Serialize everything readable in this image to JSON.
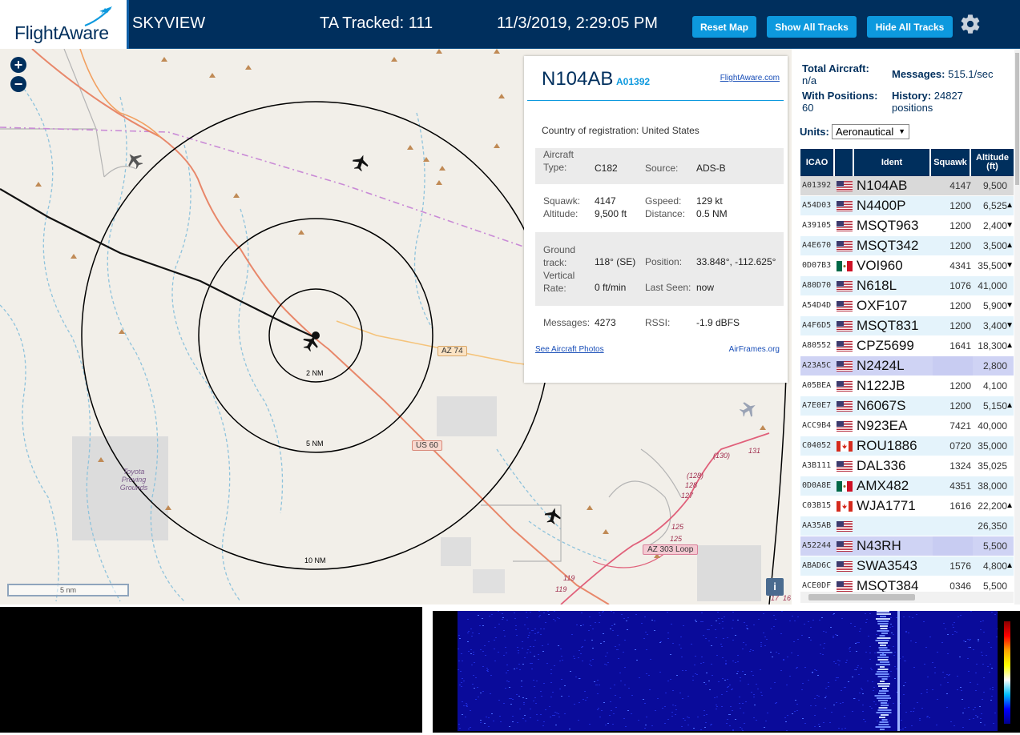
{
  "header": {
    "logo": "FlightAware",
    "site_name": "SKYVIEW",
    "ta_tracked": "TA Tracked: 111",
    "datetime": "11/3/2019, 2:29:05 PM",
    "buttons": {
      "reset": "Reset Map",
      "show": "Show All Tracks",
      "hide": "Hide All Tracks"
    },
    "colors": {
      "bar": "#002f5d",
      "button": "#0d99de"
    }
  },
  "map": {
    "zoom_in": "+",
    "zoom_out": "−",
    "range_labels": [
      "2 NM",
      "5 NM",
      "10 NM"
    ],
    "road_labels": [
      "AZ 74",
      "US 60",
      "AZ 303 Loop"
    ],
    "route_numbers": [
      "(130)",
      "131",
      "(128)",
      "128",
      "127",
      "125",
      "125",
      "119",
      "119",
      "17",
      "16"
    ],
    "place_label": "Toyota Proving Grounds",
    "scale": "5 nm",
    "info": "i"
  },
  "popup": {
    "ident": "N104AB",
    "icao": "A01392",
    "flightaware_link": "FlightAware.com",
    "country_label": "Country of registration:",
    "country": "United States",
    "aircraft_type_label": "Aircraft Type:",
    "aircraft_type": "C182",
    "source_label": "Source:",
    "source": "ADS-B",
    "squawk_label": "Squawk:",
    "squawk": "4147",
    "gspeed_label": "Gspeed:",
    "gspeed": "129 kt",
    "altitude_label": "Altitude:",
    "altitude": "9,500 ft",
    "distance_label": "Distance:",
    "distance": "0.5 NM",
    "ground_track_label": "Ground track:",
    "ground_track": "118° (SE)",
    "position_label": "Position:",
    "position": "33.848°, -112.625°",
    "vrate_label": "Vertical Rate:",
    "vrate": "0 ft/min",
    "last_seen_label": "Last Seen:",
    "last_seen": "now",
    "messages_label": "Messages:",
    "messages": "4273",
    "rssi_label": "RSSI:",
    "rssi": "-1.9 dBFS",
    "photos_link": "See Aircraft Photos",
    "airframes_link": "AirFrames.org"
  },
  "panel": {
    "total_aircraft_label": "Total Aircraft:",
    "total_aircraft": "n/a",
    "messages_label": "Messages:",
    "messages": "515.1/sec",
    "with_positions_label": "With Positions:",
    "with_positions": "60",
    "history_label": "History:",
    "history": "24827 positions",
    "units_label": "Units:",
    "units_value": "Aeronautical",
    "columns": [
      "ICAO",
      "",
      "Ident",
      "Squawk",
      "Altitude (ft)"
    ],
    "rows": [
      {
        "icao": "A01392",
        "flag": "us",
        "ident": "N104AB",
        "squawk": "4147",
        "alt": "9,500",
        "trend": "",
        "state": "sel"
      },
      {
        "icao": "A54D03",
        "flag": "us",
        "ident": "N4400P",
        "squawk": "1200",
        "alt": "6,525",
        "trend": "▲",
        "state": "odd"
      },
      {
        "icao": "A39105",
        "flag": "us",
        "ident": "MSQT963",
        "squawk": "1200",
        "alt": "2,400",
        "trend": "▼",
        "state": "even"
      },
      {
        "icao": "A4E670",
        "flag": "us",
        "ident": "MSQT342",
        "squawk": "1200",
        "alt": "3,500",
        "trend": "▲",
        "state": "odd"
      },
      {
        "icao": "0D07B3",
        "flag": "mx",
        "ident": "VOI960",
        "squawk": "4341",
        "alt": "35,500",
        "trend": "▼",
        "state": "even"
      },
      {
        "icao": "A80D70",
        "flag": "us",
        "ident": "N618L",
        "squawk": "1076",
        "alt": "41,000",
        "trend": "",
        "state": "odd"
      },
      {
        "icao": "A54D4D",
        "flag": "us",
        "ident": "OXF107",
        "squawk": "1200",
        "alt": "5,900",
        "trend": "▼",
        "state": "even"
      },
      {
        "icao": "A4F6D5",
        "flag": "us",
        "ident": "MSQT831",
        "squawk": "1200",
        "alt": "3,400",
        "trend": "▼",
        "state": "odd"
      },
      {
        "icao": "A80552",
        "flag": "us",
        "ident": "CPZ5699",
        "squawk": "1641",
        "alt": "18,300",
        "trend": "▲",
        "state": "even"
      },
      {
        "icao": "A23A5C",
        "flag": "us",
        "ident": "N2424L",
        "squawk": "",
        "alt": "2,800",
        "trend": "",
        "state": "hl"
      },
      {
        "icao": "A05BEA",
        "flag": "us",
        "ident": "N122JB",
        "squawk": "1200",
        "alt": "4,100",
        "trend": "",
        "state": "even"
      },
      {
        "icao": "A7E0E7",
        "flag": "us",
        "ident": "N6067S",
        "squawk": "1200",
        "alt": "5,150",
        "trend": "▲",
        "state": "odd"
      },
      {
        "icao": "ACC9B4",
        "flag": "us",
        "ident": "N923EA",
        "squawk": "7421",
        "alt": "40,000",
        "trend": "",
        "state": "even"
      },
      {
        "icao": "C04052",
        "flag": "ca",
        "ident": "ROU1886",
        "squawk": "0720",
        "alt": "35,000",
        "trend": "",
        "state": "odd"
      },
      {
        "icao": "A3B111",
        "flag": "us",
        "ident": "DAL336",
        "squawk": "1324",
        "alt": "35,025",
        "trend": "",
        "state": "even"
      },
      {
        "icao": "0D0A8E",
        "flag": "mx",
        "ident": "AMX482",
        "squawk": "4351",
        "alt": "38,000",
        "trend": "",
        "state": "odd"
      },
      {
        "icao": "C03B15",
        "flag": "ca",
        "ident": "WJA1771",
        "squawk": "1616",
        "alt": "22,200",
        "trend": "▲",
        "state": "even"
      },
      {
        "icao": "AA35AB",
        "flag": "us",
        "ident": "",
        "squawk": "",
        "alt": "26,350",
        "trend": "",
        "state": "odd"
      },
      {
        "icao": "A52244",
        "flag": "us",
        "ident": "N43RH",
        "squawk": "",
        "alt": "5,500",
        "trend": "",
        "state": "hl"
      },
      {
        "icao": "ABAD6C",
        "flag": "us",
        "ident": "SWA3543",
        "squawk": "1576",
        "alt": "4,800",
        "trend": "▲",
        "state": "odd"
      },
      {
        "icao": "ACE0DF",
        "flag": "us",
        "ident": "MSQT384",
        "squawk": "0346",
        "alt": "5,500",
        "trend": "",
        "state": "even"
      }
    ]
  },
  "icons": {
    "gear": "settings-gear-icon",
    "aircraft": "airplane-icon",
    "terrain_peaks": "triangle-peak-icon"
  }
}
